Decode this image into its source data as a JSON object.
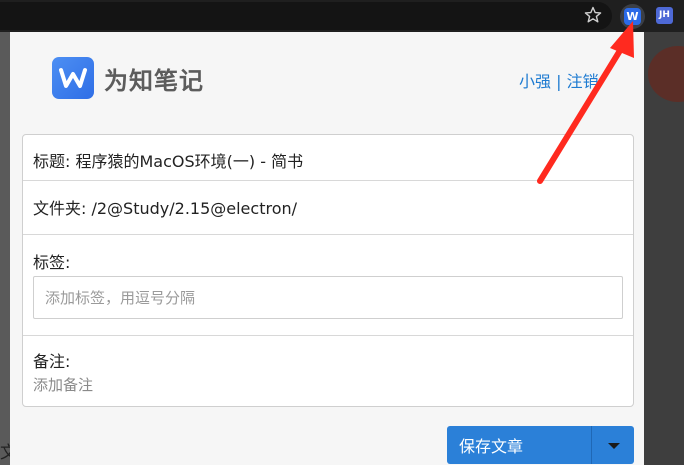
{
  "browser": {
    "star_icon": "star-icon",
    "ext_wiznote_letter": "W",
    "ext_jh_label": "JH"
  },
  "popup": {
    "brand_name": "为知笔记",
    "user_links": "小强 | 注销",
    "title_row": "标题: 程序猿的MacOS环境(一) - 简书",
    "folder_row": "文件夹: /2@Study/2.15@electron/",
    "tags_label": "标签:",
    "tags_placeholder": "添加标签，用逗号分隔",
    "notes_label": "备注:",
    "notes_placeholder": "添加备注",
    "save_button": "保存文章",
    "dropdown_icon": "caret-down-icon"
  },
  "background": {
    "stray_char": "文"
  },
  "colors": {
    "accent": "#2b80d8",
    "link": "#1e7bd1",
    "annotation_arrow": "#ff2a1f"
  }
}
